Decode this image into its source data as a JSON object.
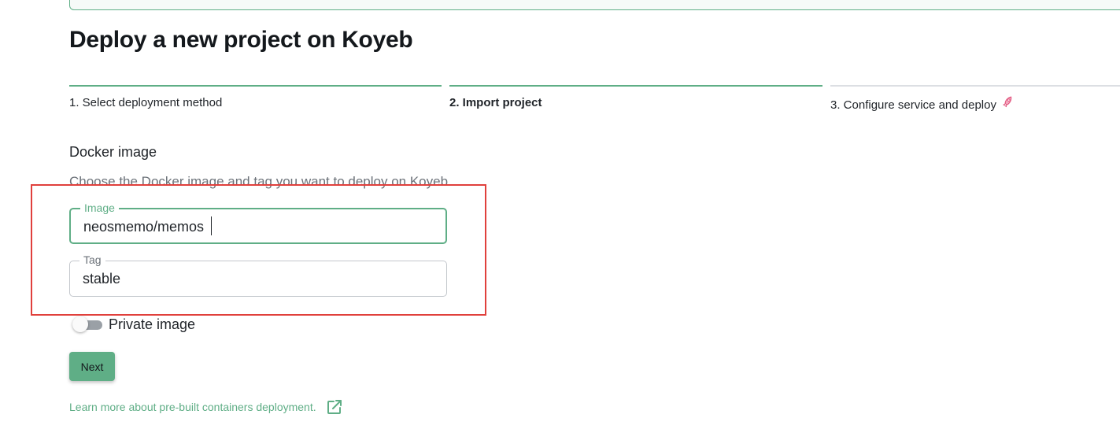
{
  "page": {
    "title": "Deploy a new project on Koyeb"
  },
  "steps": [
    {
      "label": "1. Select deployment method",
      "state": "done"
    },
    {
      "label": "2. Import project",
      "state": "active"
    },
    {
      "label": "3. Configure service and deploy",
      "state": "pending",
      "icon": "rocket-icon"
    }
  ],
  "section": {
    "title": "Docker image",
    "description": "Choose the Docker image and tag you want to deploy on Koyeb."
  },
  "fields": {
    "image": {
      "label": "Image",
      "value": "neosmemo/memos"
    },
    "tag": {
      "label": "Tag",
      "value": "stable"
    }
  },
  "toggle": {
    "label": "Private image",
    "checked": false
  },
  "actions": {
    "next_label": "Next"
  },
  "footer": {
    "learn_more": "Learn more about pre-built containers deployment.",
    "icon": "external-link-icon"
  },
  "colors": {
    "accent": "#5fae86",
    "highlight": "#e0403c",
    "text": "#1f2328",
    "muted": "#6b7178"
  }
}
